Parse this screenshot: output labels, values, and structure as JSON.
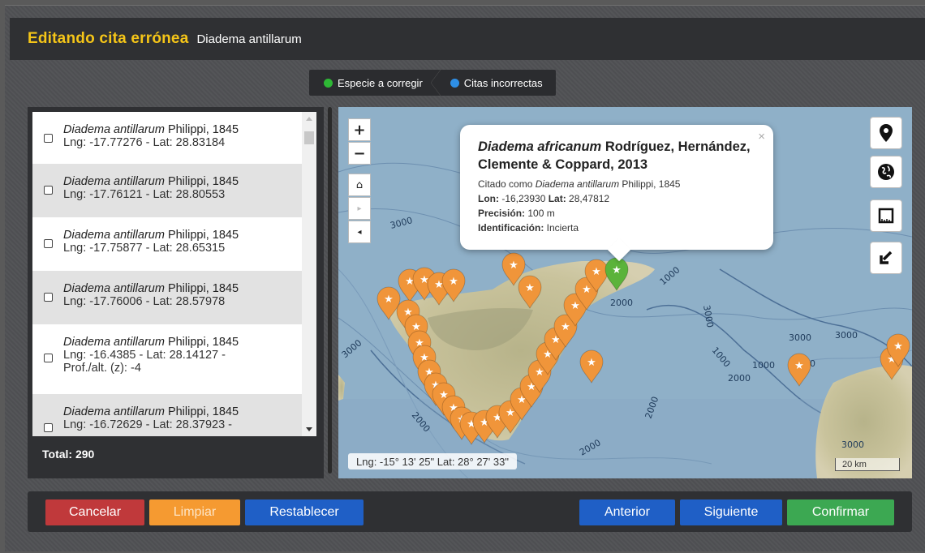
{
  "header": {
    "title": "Editando cita errónea",
    "subtitle": "Diadema antillarum"
  },
  "steps": [
    {
      "label": "Especie a corregir",
      "color": "#2eb835"
    },
    {
      "label": "Citas incorrectas",
      "color": "#2e8fe6"
    }
  ],
  "list": {
    "items": [
      {
        "species": "Diadema antillarum",
        "author": " Philippi, 1845",
        "coords": "Lng: -17.77276 - Lat: 28.83184"
      },
      {
        "species": "Diadema antillarum",
        "author": " Philippi, 1845",
        "coords": "Lng: -17.76121 - Lat: 28.80553"
      },
      {
        "species": "Diadema antillarum",
        "author": " Philippi, 1845",
        "coords": "Lng: -17.75877 - Lat: 28.65315"
      },
      {
        "species": "Diadema antillarum",
        "author": " Philippi, 1845",
        "coords": "Lng: -17.76006 - Lat: 28.57978"
      },
      {
        "species": "Diadema antillarum",
        "author": " Philippi, 1845",
        "coords": "Lng: -16.4385 - Lat: 28.14127 -",
        "coords2": "Prof./alt. (z): -4"
      },
      {
        "species": "Diadema antillarum",
        "author": " Philippi, 1845",
        "coords": "Lng: -16.72629 - Lat: 28.37923 -"
      }
    ],
    "total": "Total: 290"
  },
  "map": {
    "zoom_in": "+",
    "zoom_out": "−",
    "popup": {
      "title_species": "Diadema africanum",
      "title_author": " Rodríguez, Hernández, Clemente & Coppard, 2013",
      "cited_prefix": "Citado como ",
      "cited_species": "Diadema antillarum",
      "cited_author": " Philippi, 1845",
      "lon_label": "Lon:",
      "lon_value": " -16,23930 ",
      "lat_label": "Lat:",
      "lat_value": " 28,47812",
      "precision_label": "Precisión:",
      "precision_value": " 100 m",
      "ident_label": "Identificación:",
      "ident_value": " Incierta",
      "close": "×"
    },
    "cursor_coords": "Lng: -15° 13' 25\" Lat: 28° 27' 33\"",
    "scale": "20 km",
    "contour_labels": [
      "3000",
      "3000",
      "2000",
      "3000",
      "3000",
      "2000",
      "2000",
      "1000",
      "2000",
      "2000",
      "1000",
      "1000",
      "3000",
      "2000",
      "3000"
    ]
  },
  "footer": {
    "cancel": "Cancelar",
    "clear": "Limpiar",
    "reset": "Restablecer",
    "previous": "Anterior",
    "next": "Siguiente",
    "confirm": "Confirmar"
  }
}
